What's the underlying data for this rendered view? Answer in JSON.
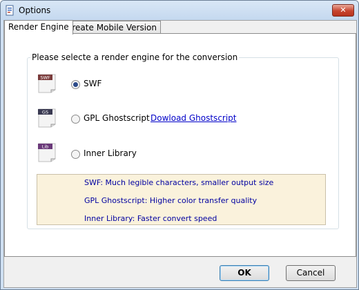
{
  "window": {
    "title": "Options",
    "close_label": "✕"
  },
  "tabs": [
    {
      "label": "Render Engine",
      "active": true
    },
    {
      "label": "Create Mobile Version",
      "active": false
    }
  ],
  "group": {
    "caption": "Please selecte a render engine for the conversion"
  },
  "engines": [
    {
      "icon": "swf-icon",
      "icon_text": "SWF",
      "label": "SWF",
      "checked": true,
      "color": "#7a3b3b"
    },
    {
      "icon": "gs-icon",
      "icon_text": "GS",
      "label": "GPL Ghostscript",
      "checked": false,
      "color": "#3a3a52",
      "link": "Dowload Ghostscript"
    },
    {
      "icon": "lib-icon",
      "icon_text": "Lib",
      "label": "Inner Library",
      "checked": false,
      "color": "#6b3a7a"
    }
  ],
  "info": [
    "SWF: Much legible characters, smaller output size",
    "GPL Ghostscript: Higher color transfer quality",
    "Inner Library: Faster convert speed"
  ],
  "buttons": {
    "ok": "OK",
    "cancel": "Cancel"
  }
}
